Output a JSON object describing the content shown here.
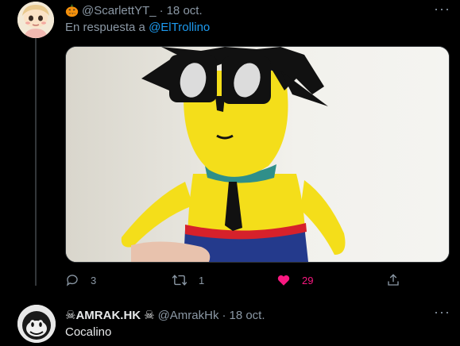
{
  "tweet1": {
    "handle": "@ScarlettYT_",
    "separator": "·",
    "date": "18 oct.",
    "reply_prefix": "En respuesta a",
    "reply_mention": "@ElTrollino",
    "more_label": "···",
    "actions": {
      "reply_count": "3",
      "retweet_count": "1",
      "like_count": "29"
    },
    "icons": [
      "pumpkin-emoji-icon",
      "reply-icon",
      "retweet-icon",
      "heart-icon",
      "share-icon",
      "more-icon"
    ]
  },
  "tweet2": {
    "skull_left": "☠",
    "display_name": "AMRAK.HK",
    "skull_right": "☠",
    "handle": "@AmrakHk",
    "separator": "·",
    "date": "18 oct.",
    "text": "Cocalino",
    "more_label": "···"
  },
  "colors": {
    "background": "#000000",
    "secondary_text": "#8b98a5",
    "primary_text": "#e7e9ea",
    "link": "#1d9bf0",
    "like": "#f91880",
    "thread_line": "#333639"
  }
}
